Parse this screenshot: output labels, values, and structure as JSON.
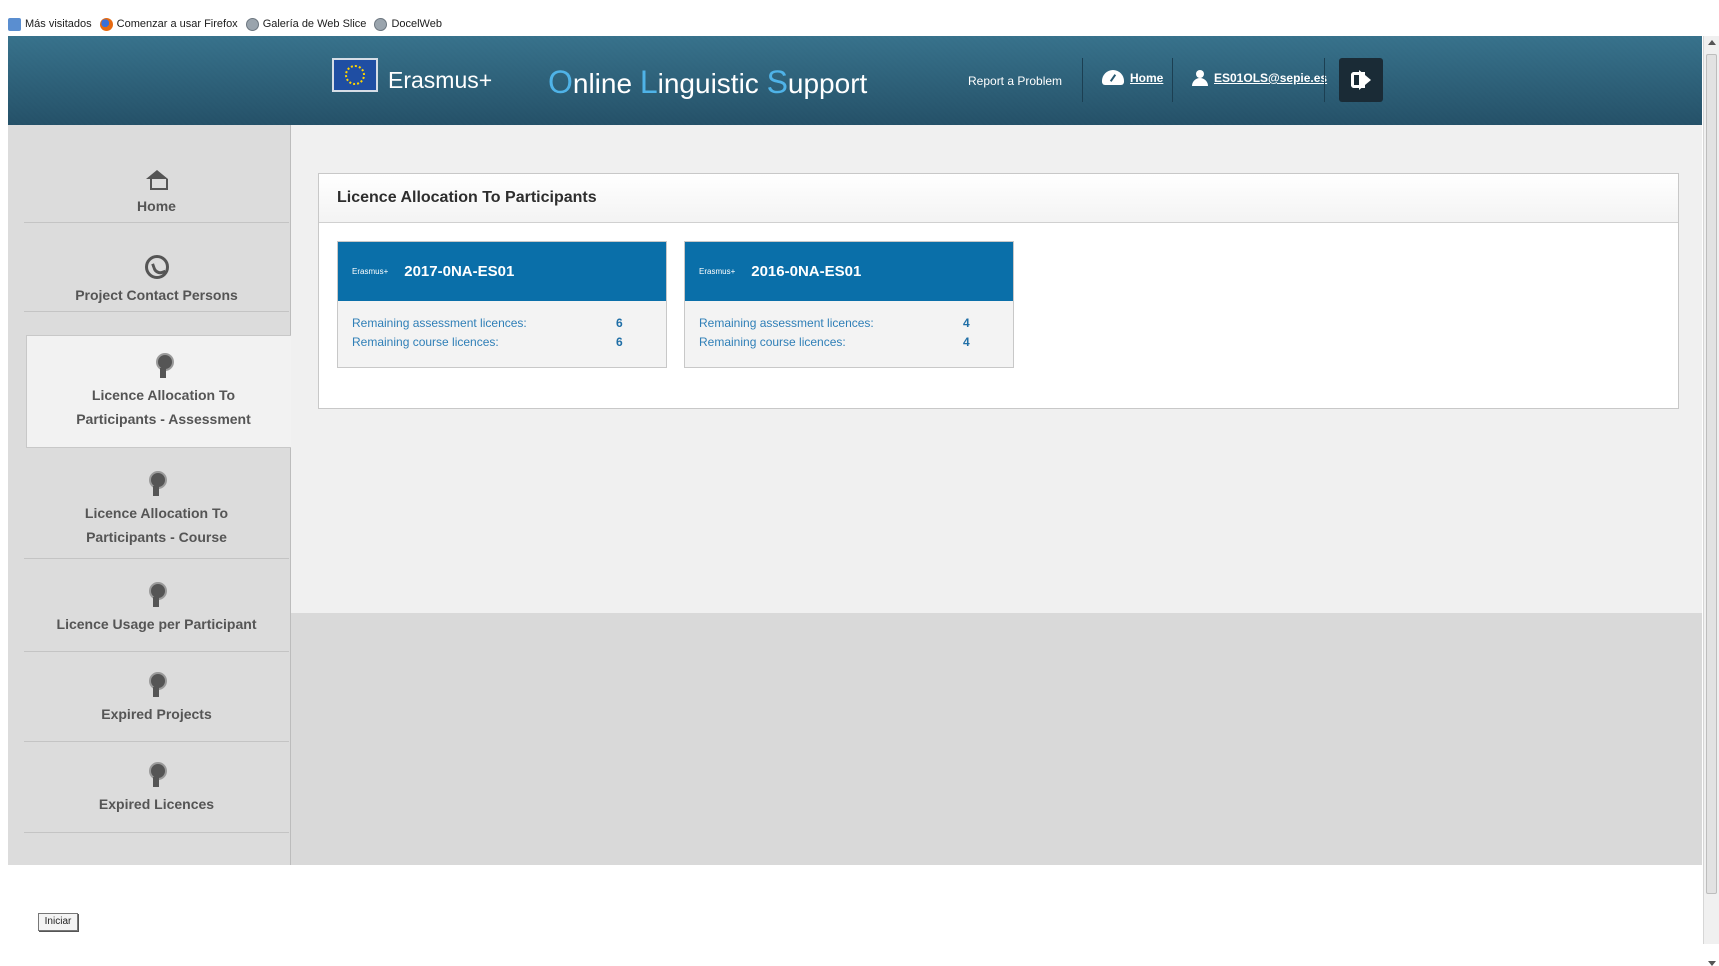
{
  "bookmarks": [
    {
      "label": "Más visitados",
      "icon": "bookmark-icon"
    },
    {
      "label": "Comenzar a usar Firefox",
      "icon": "firefox-icon"
    },
    {
      "label": "Galería de Web Slice",
      "icon": "globe-icon"
    },
    {
      "label": "DocelWeb",
      "icon": "globe-icon"
    }
  ],
  "header": {
    "brand": "Erasmus+",
    "title_parts": [
      "O",
      "nline ",
      "L",
      "inguistic ",
      "S",
      "upport"
    ],
    "report_link": "Report a Problem",
    "home_link": "Home",
    "user_link": "ES01OLS@sepie.es",
    "colors": {
      "bar": "#285870",
      "accent": "#4fb3e8"
    }
  },
  "sidebar": {
    "items": [
      {
        "label": "Home",
        "icon": "home-icon"
      },
      {
        "label": "Project Contact Persons",
        "icon": "phone-icon"
      },
      {
        "label_line1": "Licence Allocation To",
        "label_line2": "Participants - Assessment",
        "icon": "ribbon-icon",
        "active": true
      },
      {
        "label_line1": "Licence Allocation To",
        "label_line2": "Participants - Course",
        "icon": "ribbon-icon"
      },
      {
        "label": "Licence Usage per Participant",
        "icon": "ribbon-icon"
      },
      {
        "label": "Expired Projects",
        "icon": "ribbon-icon"
      },
      {
        "label": "Expired Licences",
        "icon": "ribbon-icon"
      }
    ]
  },
  "main": {
    "panel_title": "Licence Allocation To Participants",
    "cards": [
      {
        "badge": "Erasmus+",
        "code": "2017-0NA-ES01",
        "rows": [
          {
            "label": "Remaining assessment licences:",
            "value": "6"
          },
          {
            "label": "Remaining course licences:",
            "value": "6"
          }
        ]
      },
      {
        "badge": "Erasmus+",
        "code": "2016-0NA-ES01",
        "rows": [
          {
            "label": "Remaining assessment licences:",
            "value": "4"
          },
          {
            "label": "Remaining course licences:",
            "value": "4"
          }
        ]
      }
    ],
    "card_color": "#0a6fa9"
  },
  "statusbar": {
    "start_button": "Iniciar"
  }
}
